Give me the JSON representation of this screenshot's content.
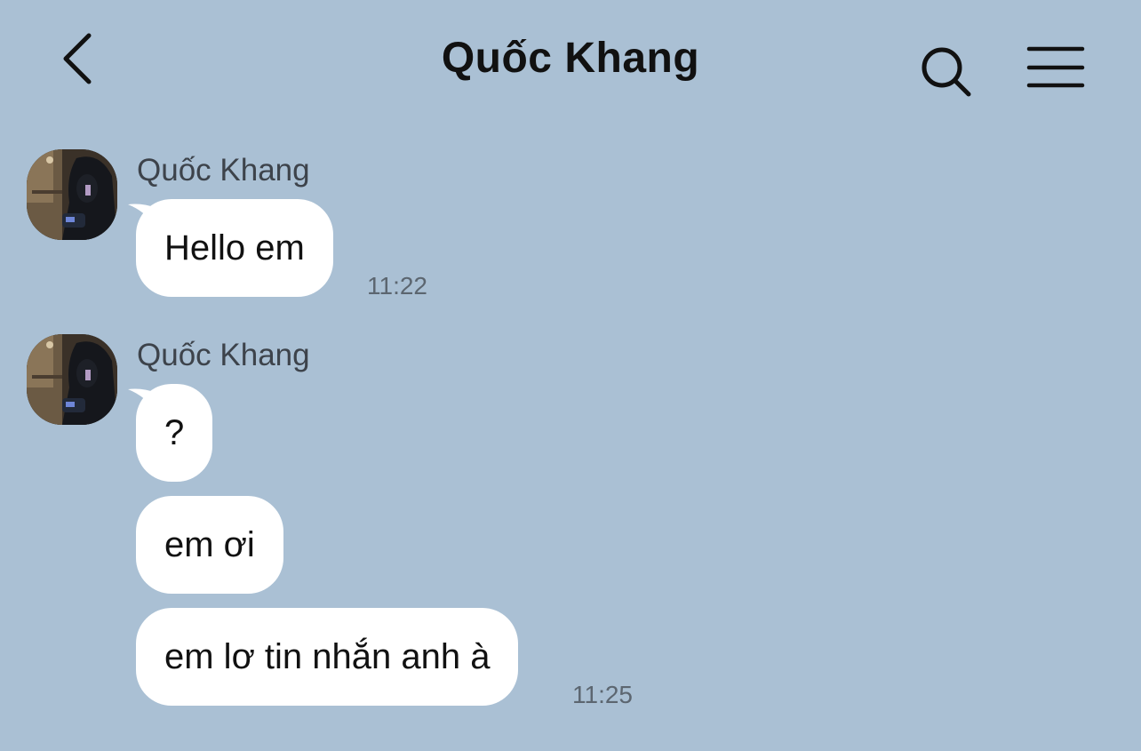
{
  "header": {
    "title": "Quốc Khang",
    "back_icon": "chevron-left-icon",
    "search_icon": "search-icon",
    "menu_icon": "hamburger-menu-icon"
  },
  "colors": {
    "background": "#aac0d4",
    "bubble": "#ffffff",
    "text": "#111111"
  },
  "messages": [
    {
      "sender": "Quốc Khang",
      "bubbles": [
        {
          "text": "Hello em",
          "time": "11:22"
        }
      ]
    },
    {
      "sender": "Quốc Khang",
      "bubbles": [
        {
          "text": "?"
        },
        {
          "text": "em ơi"
        },
        {
          "text": "em lơ tin nhắn anh à",
          "time": "11:25"
        }
      ]
    }
  ]
}
